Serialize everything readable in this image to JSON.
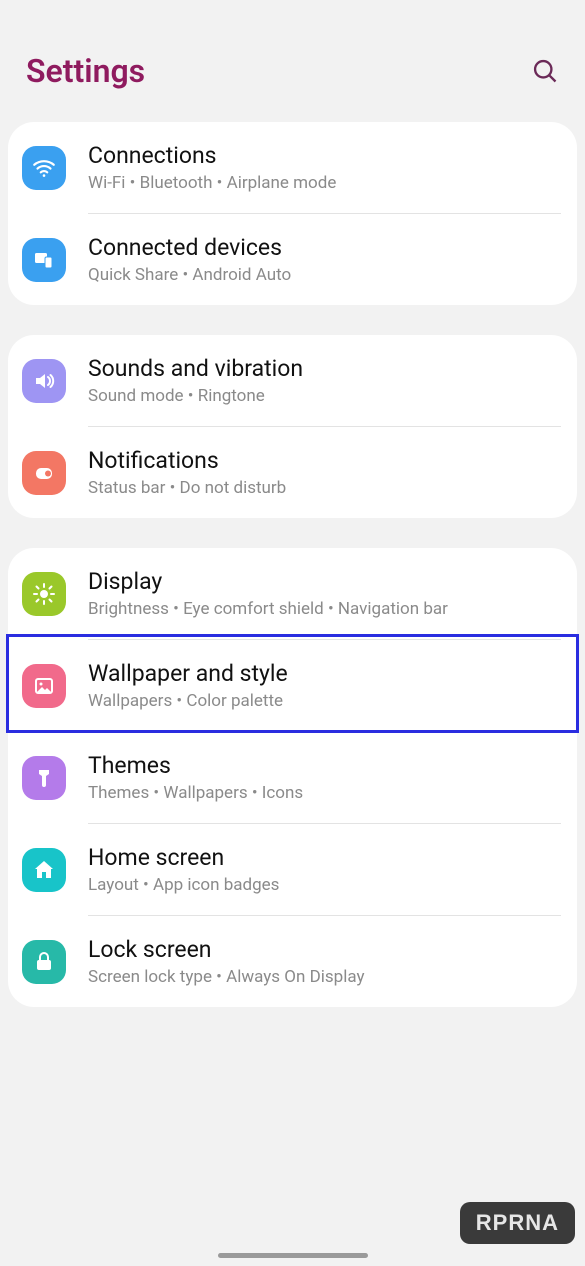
{
  "header": {
    "title": "Settings"
  },
  "groups": [
    {
      "items": [
        {
          "title": "Connections",
          "sub": "Wi-Fi  •  Bluetooth  •  Airplane mode"
        },
        {
          "title": "Connected devices",
          "sub": "Quick Share  •  Android Auto"
        }
      ]
    },
    {
      "items": [
        {
          "title": "Sounds and vibration",
          "sub": "Sound mode  •  Ringtone"
        },
        {
          "title": "Notifications",
          "sub": "Status bar  •  Do not disturb"
        }
      ]
    },
    {
      "items": [
        {
          "title": "Display",
          "sub": "Brightness  •  Eye comfort shield  •  Navigation bar"
        },
        {
          "title": "Wallpaper and style",
          "sub": "Wallpapers  •  Color palette"
        },
        {
          "title": "Themes",
          "sub": "Themes  •  Wallpapers  •  Icons"
        },
        {
          "title": "Home screen",
          "sub": "Layout  •  App icon badges"
        },
        {
          "title": "Lock screen",
          "sub": "Screen lock type  •  Always On Display"
        }
      ]
    }
  ],
  "watermark": "RPRNA"
}
